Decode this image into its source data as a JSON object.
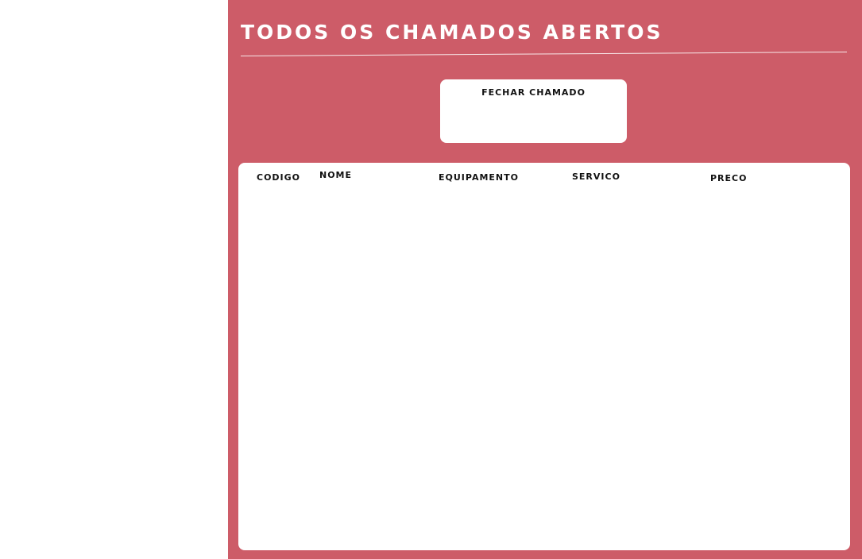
{
  "main": {
    "title": "Todos os Chamados Abertos",
    "close_panel": {
      "label": "Fechar Chamado"
    },
    "table": {
      "columns": [
        "Codigo",
        "Nome",
        "Equipamento",
        "Servico",
        "Preco"
      ],
      "rows": []
    }
  },
  "colors": {
    "main_background": "#cd5c68",
    "panel_background": "#ffffff",
    "title_text": "#ffffff"
  }
}
